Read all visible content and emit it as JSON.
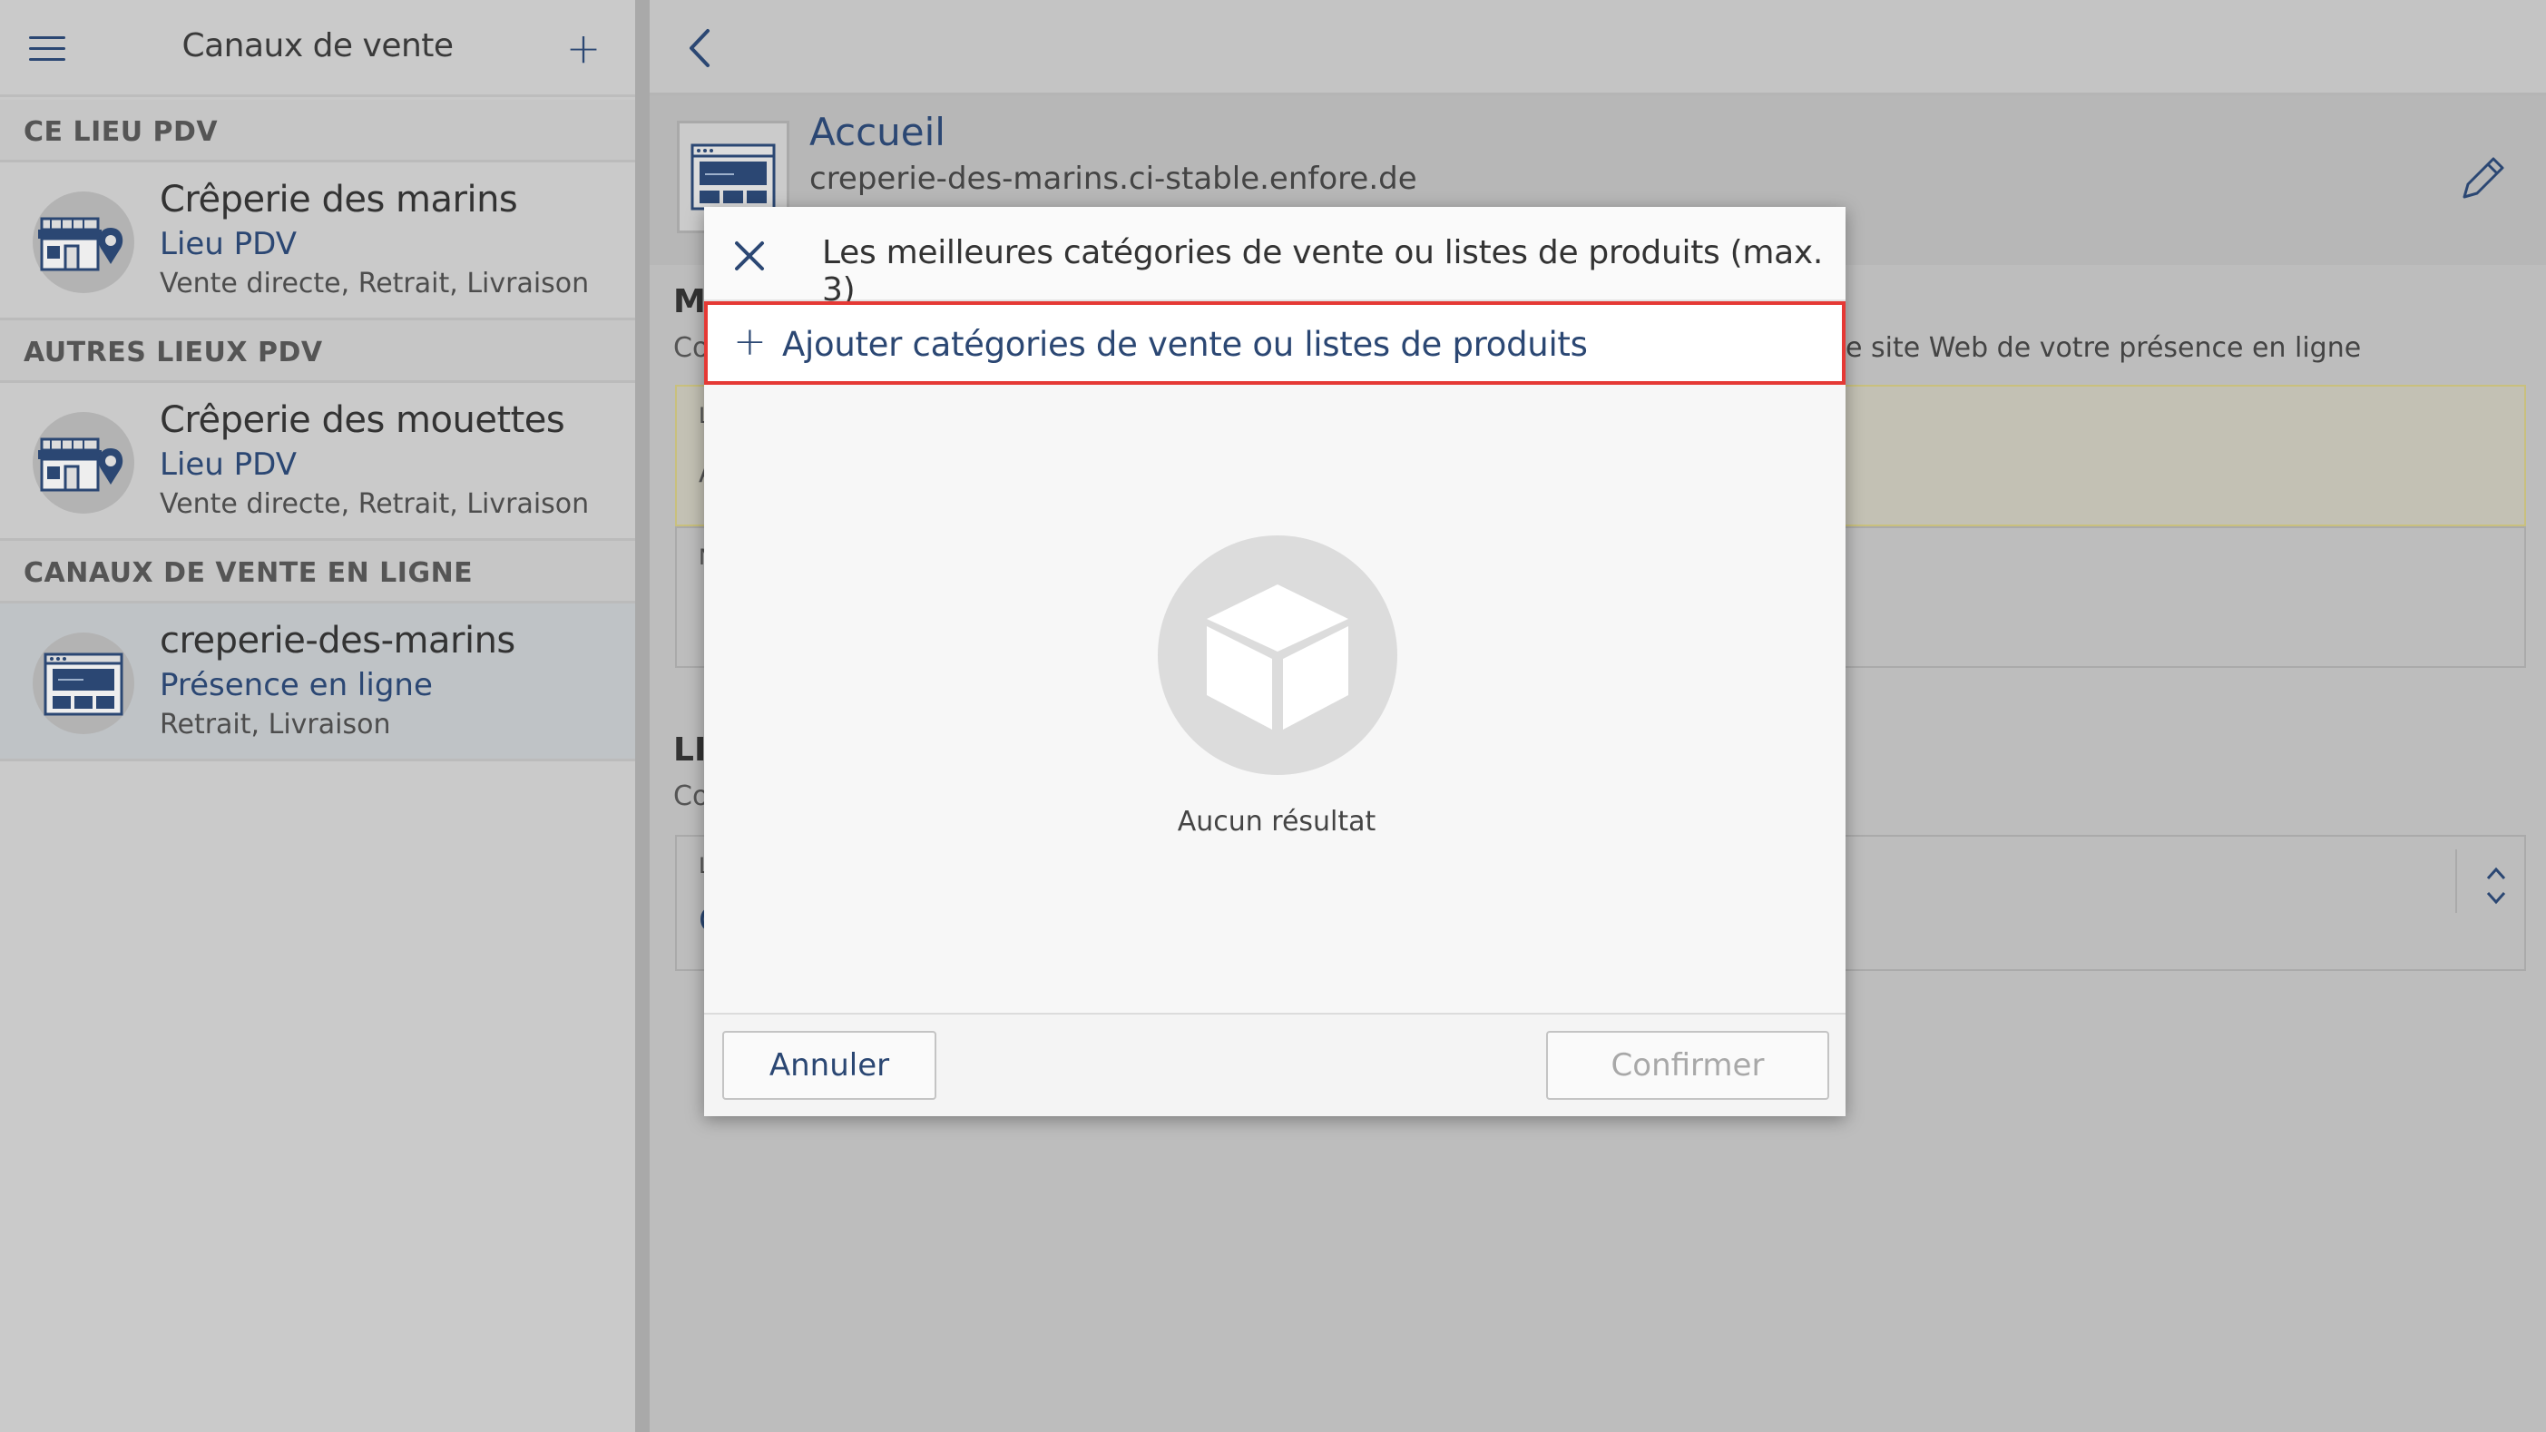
{
  "sidebar": {
    "title": "Canaux de vente",
    "sections": [
      {
        "label": "CE LIEU PDV"
      },
      {
        "label": "AUTRES LIEUX PDV"
      },
      {
        "label": "CANAUX DE VENTE EN LIGNE"
      }
    ],
    "channels": [
      {
        "name": "Crêperie des marins",
        "type": "Lieu PDV",
        "modes": "Vente directe, Retrait, Livraison",
        "icon": "store-location-icon"
      },
      {
        "name": "Crêperie des mouettes",
        "type": "Lieu PDV",
        "modes": "Vente directe, Retrait, Livraison",
        "icon": "store-location-icon"
      },
      {
        "name": "creperie-des-marins",
        "type": "Présence en ligne",
        "modes": "Retrait, Livraison",
        "icon": "website-icon"
      }
    ]
  },
  "main": {
    "page_title": "Accueil",
    "url": "creperie-des-marins.ci-stable.enfore.de",
    "partial_section_1": "M",
    "partial_section_1_desc_left": "Co",
    "partial_section_1_desc_right": "e site Web de votre présence en ligne",
    "partial_field_1": "L",
    "partial_field_1_value": "A",
    "partial_field_2": "N",
    "partial_section_2": "LI",
    "partial_section_2_desc": "Co",
    "partial_field_3": "L",
    "partial_field_3_value": "C"
  },
  "dialog": {
    "title": "Les meilleures catégories de vente ou listes de produits (max. 3)",
    "add_label": "Ajouter catégories de vente ou listes de produits",
    "empty_text": "Aucun résultat",
    "cancel_label": "Annuler",
    "confirm_label": "Confirmer"
  },
  "colors": {
    "accent": "#2b4773",
    "highlight": "#e53935"
  }
}
